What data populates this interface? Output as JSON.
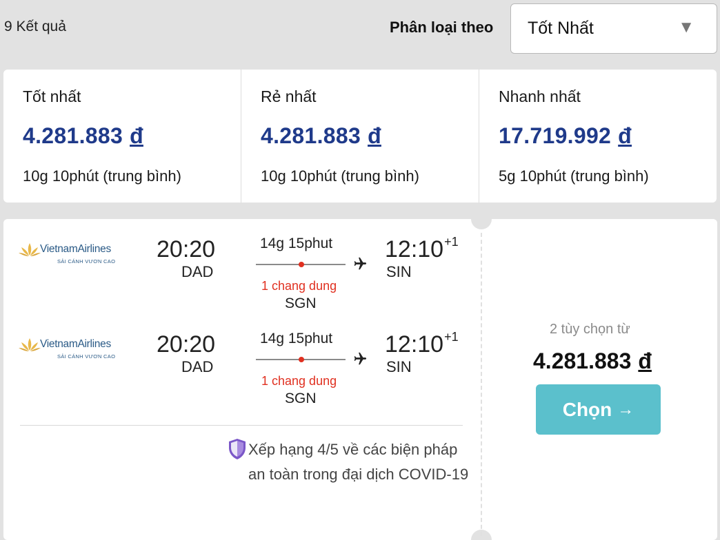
{
  "header": {
    "results_count": "9 Kết quả",
    "sort_label": "Phân loại theo",
    "sort_value": "Tốt Nhất"
  },
  "summary": [
    {
      "title": "Tốt nhất",
      "price": "4.281.883",
      "currency": "đ",
      "duration": "10g 10phút (trung bình)"
    },
    {
      "title": "Rẻ nhất",
      "price": "4.281.883",
      "currency": "đ",
      "duration": "10g 10phút (trung bình)"
    },
    {
      "title": "Nhanh nhất",
      "price": "17.719.992",
      "currency": "đ",
      "duration": "5g 10phút (trung bình)"
    }
  ],
  "flight": {
    "legs": [
      {
        "airline": "VietnamAirlines",
        "airline_tagline": "SẢI CÁNH VƯƠN CAO",
        "dep_time": "20:20",
        "dep_code": "DAD",
        "duration": "14g 15phut",
        "stops": "1 chang dung",
        "stop_code": "SGN",
        "arr_time": "12:10",
        "arr_day_offset": "+1",
        "arr_code": "SIN"
      },
      {
        "airline": "VietnamAirlines",
        "airline_tagline": "SẢI CÁNH VƯƠN CAO",
        "dep_time": "20:20",
        "dep_code": "DAD",
        "duration": "14g 15phut",
        "stops": "1 chang dung",
        "stop_code": "SGN",
        "arr_time": "12:10",
        "arr_day_offset": "+1",
        "arr_code": "SIN"
      }
    ],
    "safety_text": "Xếp hạng 4/5 về các biện pháp an toàn trong đại dịch COVID-19",
    "options_from": "2 tùy chọn từ",
    "total_price": "4.281.883",
    "currency": "đ",
    "select_label": "Chọn",
    "select_arrow": "→"
  },
  "colors": {
    "price_blue": "#1f3a8a",
    "stop_red": "#e03020",
    "button_teal": "#5bc0cc",
    "shield_purple": "#7b57c8"
  }
}
